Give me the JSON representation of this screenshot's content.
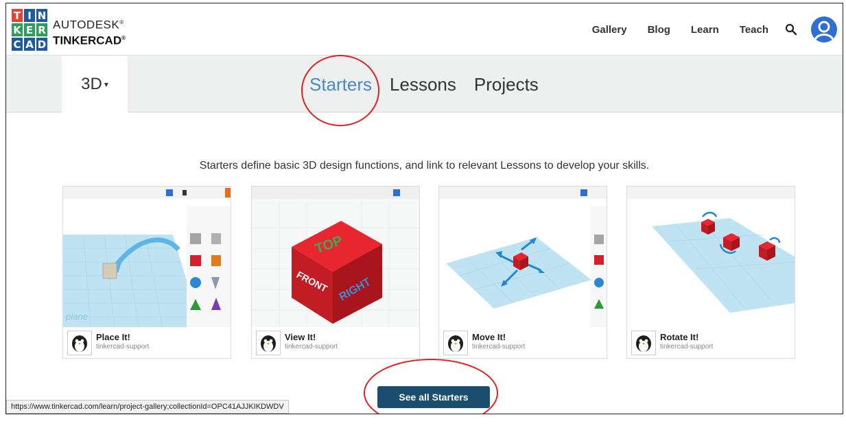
{
  "logo": {
    "letters": [
      "T",
      "I",
      "N",
      "K",
      "E",
      "R",
      "C",
      "A",
      "D"
    ],
    "colors": [
      "#e8412f",
      "#1f5aa0",
      "#1f5aa0",
      "#2b9e5a",
      "#2b9e5a",
      "#2b9e5a",
      "#1f5aa0",
      "#1f5aa0",
      "#1f5aa0"
    ],
    "brand_line1": "AUTODESK",
    "brand_line2": "TINKERCAD",
    "reg_mark": "®"
  },
  "nav": {
    "gallery": "Gallery",
    "blog": "Blog",
    "learn": "Learn",
    "teach": "Teach",
    "search_icon": "search-icon",
    "avatar_icon": "user-avatar-icon"
  },
  "subnav": {
    "dropdown_label": "3D",
    "dropdown_caret": "▾",
    "tabs": [
      "Starters",
      "Lessons",
      "Projects"
    ],
    "active_tab": "Starters",
    "active_color": "#4a88c4"
  },
  "description": "Starters define basic 3D design functions, and link to relevant Lessons to develop your skills.",
  "cards": [
    {
      "title": "Place It!",
      "user": "tinkercad-support"
    },
    {
      "title": "View It!",
      "user": "tinkercad-support"
    },
    {
      "title": "Move It!",
      "user": "tinkercad-support"
    },
    {
      "title": "Rotate It!",
      "user": "tinkercad-support"
    }
  ],
  "thumb_text": {
    "view_top": "TOP",
    "view_front": "FRONT",
    "view_right": "RIGHT",
    "workplane": "plane"
  },
  "see_all_label": "See all Starters",
  "status_url": "https://www.tinkercad.com/learn/project-gallery;collectionId=OPC41AJJKIKDWDV",
  "colors": {
    "button": "#1b4e6e",
    "annotation": "#e02020",
    "workplane": "#bfe3f2",
    "cube_red": "#d4202a"
  }
}
